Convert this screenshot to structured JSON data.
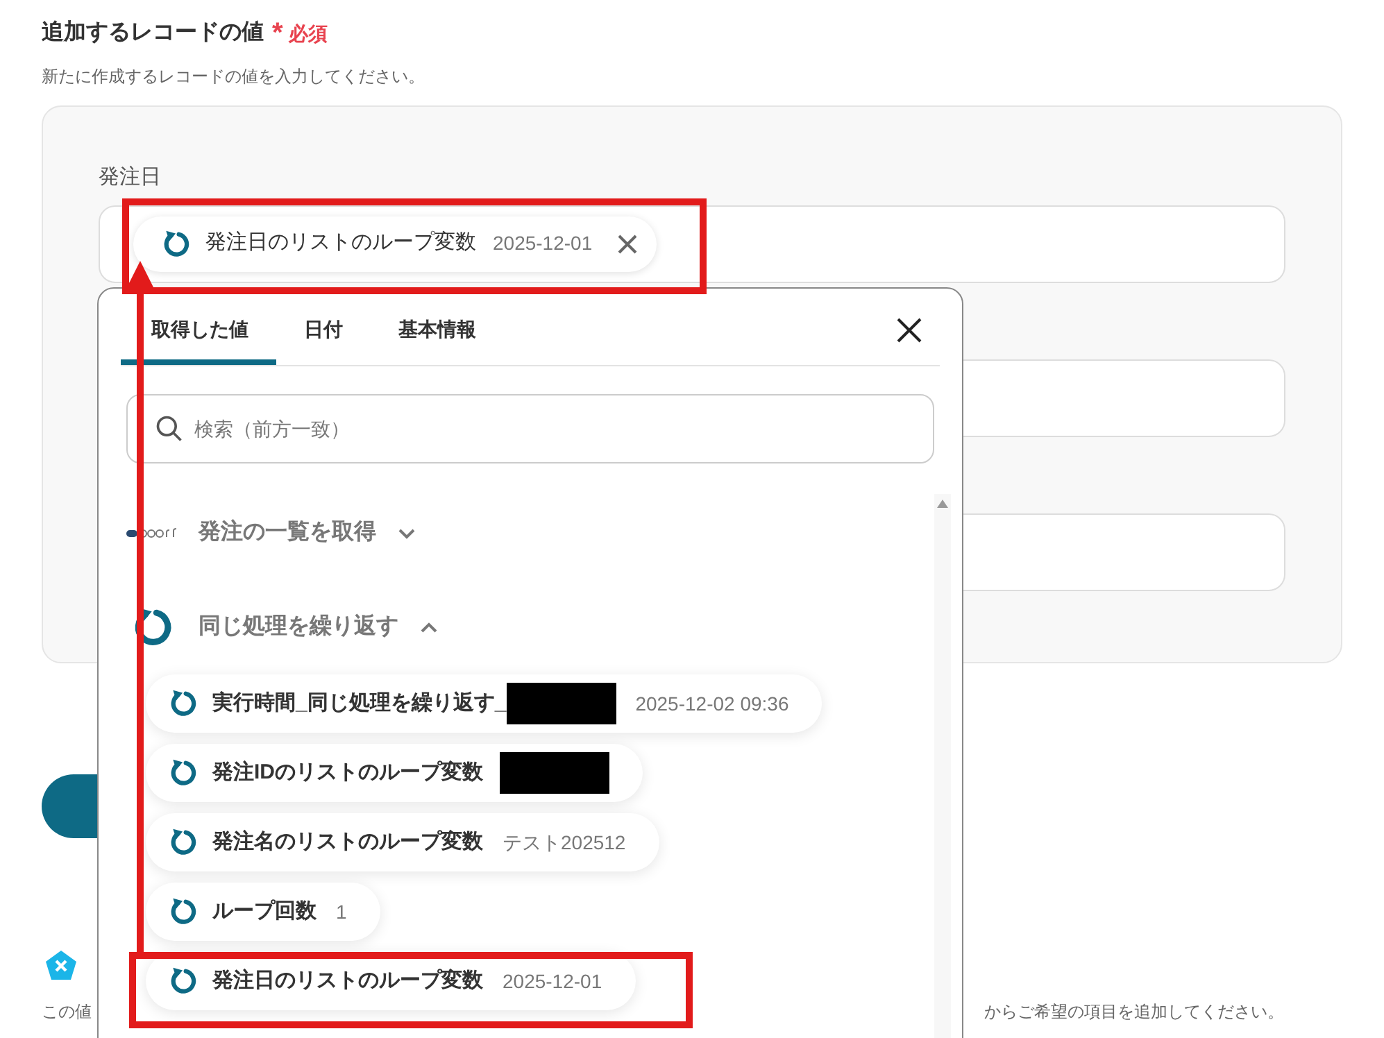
{
  "section": {
    "title": "追加するレコードの値",
    "required_mark": "*",
    "required_label": "必須",
    "description": "新たに作成するレコードの値を入力してください。"
  },
  "fields": [
    {
      "kind": "chip",
      "label": "発注日",
      "chip": {
        "name": "発注日のリストのループ変数",
        "value": "2025-12-01"
      }
    },
    {
      "kind": "empty"
    },
    {
      "kind": "empty"
    }
  ],
  "note": {
    "text_start": "この値",
    "text_end": "からご希望の項目を追加してください。"
  },
  "popup": {
    "tabs": [
      {
        "label": "取得した値",
        "selected": true
      },
      {
        "label": "日付",
        "selected": false
      },
      {
        "label": "基本情報",
        "selected": false
      }
    ],
    "search": {
      "placeholder": "検索（前方一致）"
    },
    "groups": [
      {
        "kind": "board",
        "title": "発注の一覧を取得",
        "expanded": false
      },
      {
        "kind": "loop",
        "title": "同じ処理を繰り返す",
        "expanded": true,
        "items": [
          {
            "name": "実行時間_同じ処理を繰り返す_",
            "redacted": true,
            "value": "2025-12-02 09:36"
          },
          {
            "name": "発注IDのリストのループ変数",
            "redacted": true
          },
          {
            "name": "発注名のリストのループ変数",
            "redacted": false,
            "value": "テスト202512"
          },
          {
            "name": "ループ回数",
            "redacted": false,
            "value": "1"
          },
          {
            "name": "発注日のリストのループ変数",
            "redacted": false,
            "value": "2025-12-01",
            "highlighted": true
          }
        ]
      }
    ]
  }
}
